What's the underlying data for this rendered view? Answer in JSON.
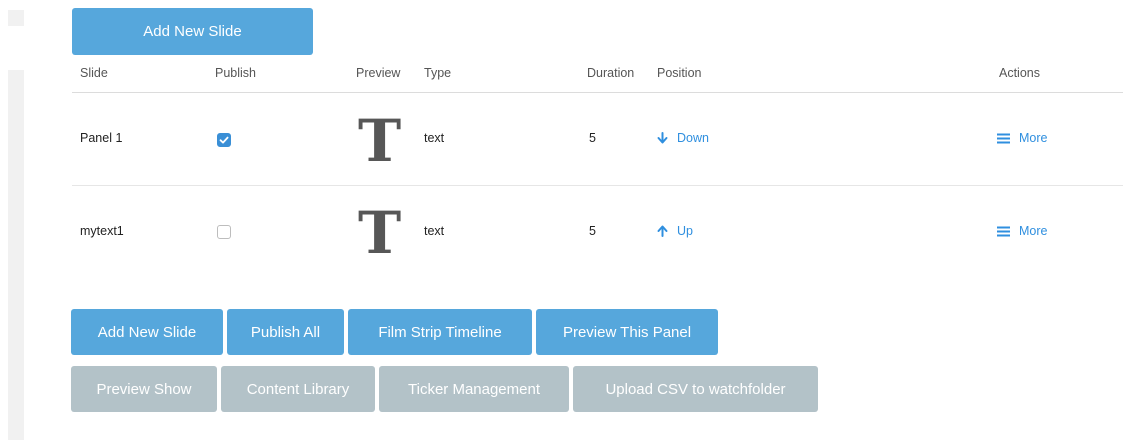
{
  "top_button": {
    "label": "Add New Slide"
  },
  "table": {
    "headers": [
      "Slide",
      "Publish",
      "Preview",
      "Type",
      "Duration",
      "Position",
      "Actions"
    ],
    "rows": [
      {
        "slide": "Panel 1",
        "published": true,
        "preview": "T",
        "type": "text",
        "duration": "5",
        "position_label": "Down",
        "position_icon": "arrow-down-icon",
        "actions_label": "More",
        "actions_icon": "menu-icon"
      },
      {
        "slide": "mytext1",
        "published": false,
        "preview": "T",
        "type": "text",
        "duration": "5",
        "position_label": "Up",
        "position_icon": "arrow-up-icon",
        "actions_label": "More",
        "actions_icon": "menu-icon"
      }
    ]
  },
  "bottom_buttons_primary": [
    "Add New Slide",
    "Publish All",
    "Film Strip Timeline",
    "Preview This Panel"
  ],
  "bottom_buttons_secondary": [
    "Preview Show",
    "Content Library",
    "Ticker Management",
    "Upload CSV to watchfolder"
  ],
  "colors": {
    "primary_button": "#56a7dc",
    "secondary_button": "#b3c2c8",
    "link": "#2f8fdf",
    "checkbox_checked": "#3a8fd6"
  }
}
